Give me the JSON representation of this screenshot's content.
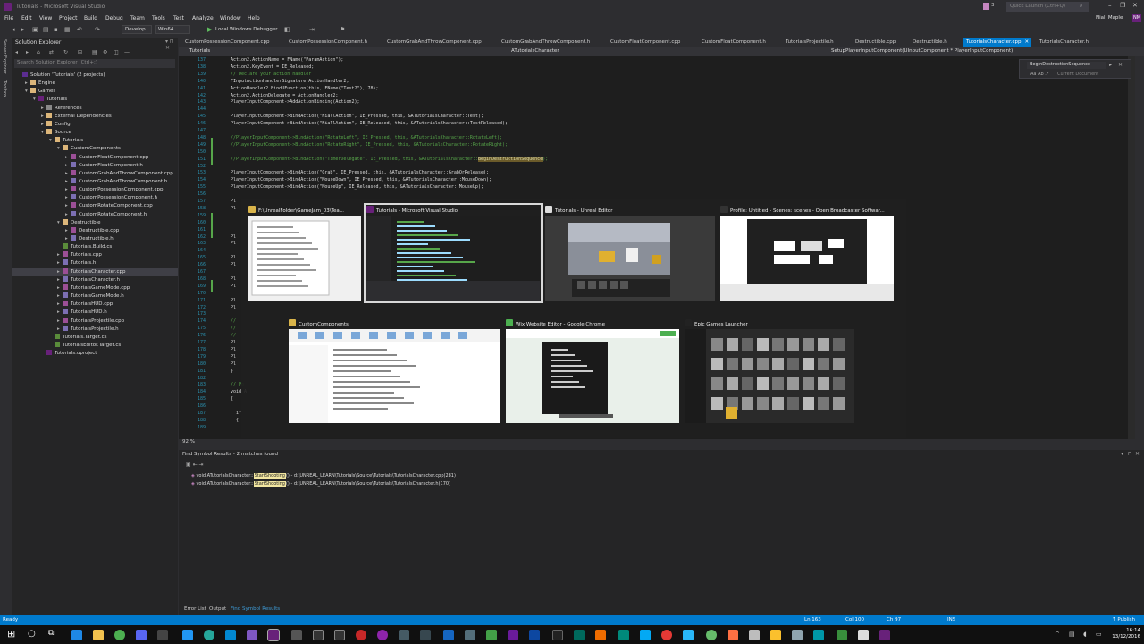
{
  "window": {
    "title": "Tutorials - Microsoft Visual Studio",
    "quick_launch_placeholder": "Quick Launch (Ctrl+Q)",
    "notifications_count": "3",
    "user_name": "Niall Maple",
    "user_initials": "NM"
  },
  "menu": [
    "File",
    "Edit",
    "View",
    "Project",
    "Build",
    "Debug",
    "Team",
    "Tools",
    "Test",
    "Analyze",
    "Window",
    "Help"
  ],
  "toolbar": {
    "config": "Develop",
    "platform": "Win64",
    "debugger": "Local Windows Debugger"
  },
  "side_tabs": [
    "Server Explorer",
    "Toolbox"
  ],
  "solution_explorer": {
    "title": "Solution Explorer",
    "search_placeholder": "Search Solution Explorer (Ctrl+;)",
    "items": [
      {
        "label": "Solution 'Tutorials' (2 projects)",
        "depth": 0,
        "kind": "sol",
        "arrow": ""
      },
      {
        "label": "Engine",
        "depth": 1,
        "kind": "folder",
        "arrow": "▸"
      },
      {
        "label": "Games",
        "depth": 1,
        "kind": "folder",
        "arrow": "▾"
      },
      {
        "label": "Tutorials",
        "depth": 2,
        "kind": "proj",
        "arrow": "▾"
      },
      {
        "label": "References",
        "depth": 3,
        "kind": "ref",
        "arrow": "▸"
      },
      {
        "label": "External Dependencies",
        "depth": 3,
        "kind": "folder",
        "arrow": "▸"
      },
      {
        "label": "Config",
        "depth": 3,
        "kind": "folder",
        "arrow": "▸"
      },
      {
        "label": "Source",
        "depth": 3,
        "kind": "folder",
        "arrow": "▾"
      },
      {
        "label": "Tutorials",
        "depth": 4,
        "kind": "folder",
        "arrow": "▾"
      },
      {
        "label": "CustomComponents",
        "depth": 5,
        "kind": "folder",
        "arrow": "▾"
      },
      {
        "label": "CustomFloatComponent.cpp",
        "depth": 6,
        "kind": "cpp",
        "arrow": "▸"
      },
      {
        "label": "CustomFloatComponent.h",
        "depth": 6,
        "kind": "h",
        "arrow": "▸"
      },
      {
        "label": "CustomGrabAndThrowComponent.cpp",
        "depth": 6,
        "kind": "cpp",
        "arrow": "▸"
      },
      {
        "label": "CustomGrabAndThrowComponent.h",
        "depth": 6,
        "kind": "h",
        "arrow": "▸"
      },
      {
        "label": "CustomPossessionComponent.cpp",
        "depth": 6,
        "kind": "cpp",
        "arrow": "▸"
      },
      {
        "label": "CustomPossessionComponent.h",
        "depth": 6,
        "kind": "h",
        "arrow": "▸"
      },
      {
        "label": "CustomRotateComponent.cpp",
        "depth": 6,
        "kind": "cpp",
        "arrow": "▸"
      },
      {
        "label": "CustomRotateComponent.h",
        "depth": 6,
        "kind": "h",
        "arrow": "▸"
      },
      {
        "label": "Destructible",
        "depth": 5,
        "kind": "folder",
        "arrow": "▾"
      },
      {
        "label": "Destructible.cpp",
        "depth": 6,
        "kind": "cpp",
        "arrow": "▸"
      },
      {
        "label": "Destructible.h",
        "depth": 6,
        "kind": "h",
        "arrow": "▸"
      },
      {
        "label": "Tutorials.Build.cs",
        "depth": 5,
        "kind": "cs",
        "arrow": ""
      },
      {
        "label": "Tutorials.cpp",
        "depth": 5,
        "kind": "cpp",
        "arrow": "▸"
      },
      {
        "label": "Tutorials.h",
        "depth": 5,
        "kind": "h",
        "arrow": "▸"
      },
      {
        "label": "TutorialsCharacter.cpp",
        "depth": 5,
        "kind": "cpp",
        "arrow": "▸",
        "selected": true
      },
      {
        "label": "TutorialsCharacter.h",
        "depth": 5,
        "kind": "h",
        "arrow": "▸"
      },
      {
        "label": "TutorialsGameMode.cpp",
        "depth": 5,
        "kind": "cpp",
        "arrow": "▸"
      },
      {
        "label": "TutorialsGameMode.h",
        "depth": 5,
        "kind": "h",
        "arrow": "▸"
      },
      {
        "label": "TutorialsHUD.cpp",
        "depth": 5,
        "kind": "cpp",
        "arrow": "▸"
      },
      {
        "label": "TutorialsHUD.h",
        "depth": 5,
        "kind": "h",
        "arrow": "▸"
      },
      {
        "label": "TutorialsProjectile.cpp",
        "depth": 5,
        "kind": "cpp",
        "arrow": "▸"
      },
      {
        "label": "TutorialsProjectile.h",
        "depth": 5,
        "kind": "h",
        "arrow": "▸"
      },
      {
        "label": "Tutorials.Target.cs",
        "depth": 4,
        "kind": "cs",
        "arrow": ""
      },
      {
        "label": "TutorialsEditor.Target.cs",
        "depth": 4,
        "kind": "cs",
        "arrow": ""
      },
      {
        "label": "Tutorials.uproject",
        "depth": 3,
        "kind": "proj",
        "arrow": ""
      }
    ]
  },
  "doc_tabs": [
    {
      "label": "CustomPossessionComponent.cpp"
    },
    {
      "label": "CustomPossessionComponent.h"
    },
    {
      "label": "CustomGrabAndThrowComponent.cpp"
    },
    {
      "label": "CustomGrabAndThrowComponent.h"
    },
    {
      "label": "CustomFloatComponent.cpp"
    },
    {
      "label": "CustomFloatComponent.h"
    },
    {
      "label": "TutorialsProjectile.h"
    },
    {
      "label": "Destructible.cpp"
    },
    {
      "label": "Destructible.h"
    },
    {
      "label": "TutorialsCharacter.cpp",
      "active": true
    },
    {
      "label": "TutorialsCharacter.h"
    }
  ],
  "nav": {
    "project": "Tutorials",
    "scope": "ATutorialsCharacter",
    "member": "SetupPlayerInputComponent(UInputComponent * PlayerInputComponent)"
  },
  "find_widget": {
    "query": "BeginDestructionSequence",
    "match_case": "Aa",
    "whole_word": "Ab",
    "regex": ".*",
    "scope": "Current Document"
  },
  "code": [
    {
      "n": "137",
      "t": "Action2.ActionName = FName(\"ParamAction\");",
      "c": ""
    },
    {
      "n": "138",
      "t": "Action2.KeyEvent = IE_Released;",
      "c": ""
    },
    {
      "n": "139",
      "t": "// Declare your action handler",
      "c": "cmt"
    },
    {
      "n": "140",
      "t": "FInputActionHandlerSignature ActionHandler2;",
      "c": ""
    },
    {
      "n": "141",
      "t": "ActionHandler2.BindUFunction(this, FName(\"Test2\"), 78);",
      "c": ""
    },
    {
      "n": "142",
      "t": "Action2.ActionDelegate = ActionHandler2;",
      "c": ""
    },
    {
      "n": "143",
      "t": "PlayerInputComponent->AddActionBinding(Action2);",
      "c": ""
    },
    {
      "n": "144",
      "t": "",
      "c": ""
    },
    {
      "n": "145",
      "t": "PlayerInputComponent->BindAction(\"NiallAction\", IE_Pressed, this, &ATutorialsCharacter::Test);",
      "c": ""
    },
    {
      "n": "146",
      "t": "PlayerInputComponent->BindAction(\"NiallAction\", IE_Released, this, &ATutorialsCharacter::TestReleased);",
      "c": ""
    },
    {
      "n": "147",
      "t": "",
      "c": ""
    },
    {
      "n": "148",
      "t": "//PlayerInputComponent->BindAction(\"RotateLeft\", IE_Pressed, this, &ATutorialsCharacter::RotateLeft);",
      "c": "cmt"
    },
    {
      "n": "149",
      "t": "//PlayerInputComponent->BindAction(\"RotateRight\", IE_Pressed, this, &ATutorialsCharacter::RotateRight);",
      "c": "cmt"
    },
    {
      "n": "150",
      "t": "",
      "c": ""
    },
    {
      "n": "151",
      "t": "//PlayerInputComponent->BindAction(\"TimerDelegate\", IE_Pressed, this, &ATutorialsCharacter::BeginDestructionSequence);",
      "c": "cmt"
    },
    {
      "n": "152",
      "t": "",
      "c": ""
    },
    {
      "n": "153",
      "t": "PlayerInputComponent->BindAction(\"Grab\", IE_Pressed, this, &ATutorialsCharacter::GrabOrRelease);",
      "c": ""
    },
    {
      "n": "154",
      "t": "PlayerInputComponent->BindAction(\"MouseDown\", IE_Pressed, this, &ATutorialsCharacter::MouseDown);",
      "c": ""
    },
    {
      "n": "155",
      "t": "PlayerInputComponent->BindAction(\"MouseUp\", IE_Released, this, &ATutorialsCharacter::MouseUp);",
      "c": ""
    },
    {
      "n": "156",
      "t": "",
      "c": ""
    },
    {
      "n": "157",
      "t": "Pl",
      "c": ""
    },
    {
      "n": "158",
      "t": "Pl",
      "c": ""
    },
    {
      "n": "159",
      "t": "",
      "c": ""
    },
    {
      "n": "160",
      "t": "",
      "c": ""
    },
    {
      "n": "161",
      "t": "",
      "c": ""
    },
    {
      "n": "162",
      "t": "Pl",
      "c": ""
    },
    {
      "n": "163",
      "t": "Pl",
      "c": ""
    },
    {
      "n": "164",
      "t": "",
      "c": ""
    },
    {
      "n": "165",
      "t": "Pl",
      "c": ""
    },
    {
      "n": "166",
      "t": "Pl",
      "c": ""
    },
    {
      "n": "167",
      "t": "",
      "c": ""
    },
    {
      "n": "168",
      "t": "Pl",
      "c": ""
    },
    {
      "n": "169",
      "t": "Pl",
      "c": ""
    },
    {
      "n": "170",
      "t": "",
      "c": ""
    },
    {
      "n": "171",
      "t": "Pl",
      "c": ""
    },
    {
      "n": "172",
      "t": "Pl",
      "c": ""
    },
    {
      "n": "173",
      "t": "",
      "c": ""
    },
    {
      "n": "174",
      "t": "//",
      "c": "cmt"
    },
    {
      "n": "175",
      "t": "//",
      "c": "cmt"
    },
    {
      "n": "176",
      "t": "//",
      "c": "cmt"
    },
    {
      "n": "177",
      "t": "Pl",
      "c": ""
    },
    {
      "n": "178",
      "t": "Pl",
      "c": ""
    },
    {
      "n": "179",
      "t": "Pl",
      "c": ""
    },
    {
      "n": "180",
      "t": "Pl",
      "c": ""
    },
    {
      "n": "181",
      "t": "}",
      "c": ""
    },
    {
      "n": "182",
      "t": "",
      "c": ""
    },
    {
      "n": "183",
      "t": "// Po",
      "c": "cmt"
    },
    {
      "n": "184",
      "t": "void A",
      "c": ""
    },
    {
      "n": "185",
      "t": "{",
      "c": ""
    },
    {
      "n": "186",
      "t": "",
      "c": ""
    },
    {
      "n": "187",
      "t": "  if",
      "c": ""
    },
    {
      "n": "188",
      "t": "  {",
      "c": ""
    },
    {
      "n": "189",
      "t": "",
      "c": ""
    }
  ],
  "editor_zoom": "92 %",
  "alt_tab": [
    {
      "title": "F:\\UnrealFolder\\GameJam_03\\Tea...",
      "icon": "#d9b44a",
      "theme": "doc"
    },
    {
      "title": "Tutorials - Microsoft Visual Studio",
      "icon": "#68217a",
      "theme": "vs",
      "selected": true
    },
    {
      "title": "Tutorials - Unreal Editor",
      "icon": "#dddddd",
      "theme": "ue"
    },
    {
      "title": "Profile: Untitled - Scenes: scenes - Open Broadcaster Softwar...",
      "icon": "#333333",
      "theme": "obs"
    },
    {
      "title": "CustomComponents",
      "icon": "#d9b44a",
      "theme": "explorer"
    },
    {
      "title": "Wix Website Editor - Google Chrome",
      "icon": "#4caf50",
      "theme": "wix"
    },
    {
      "title": "Epic Games Launcher",
      "icon": "#222222",
      "theme": "epic"
    }
  ],
  "find_results": {
    "title": "Find Symbol Results - 2 matches found",
    "rows": [
      {
        "pre": "void ATutorialsCharacter::",
        "match": "StartShooting",
        "post": "() - d:\\UNREAL_LEARN\\Tutorials\\Source\\Tutorials\\TutorialsCharacter.cpp(281)"
      },
      {
        "pre": "void ATutorialsCharacter::",
        "match": "StartShooting",
        "post": "() - d:\\UNREAL_LEARN\\Tutorials\\Source\\Tutorials\\TutorialsCharacter.h(170)"
      }
    ]
  },
  "bottom_tabs": [
    {
      "label": "Error List"
    },
    {
      "label": "Output"
    },
    {
      "label": "Find Symbol Results",
      "active": true
    }
  ],
  "status": {
    "ready": "Ready",
    "line": "Ln 163",
    "col": "Col 100",
    "ch": "Ch 97",
    "ins": "INS",
    "publish": "↑ Publish"
  },
  "clock": {
    "time": "16:14",
    "date": "13/12/2016"
  },
  "colors": {
    "accent": "#007acc",
    "vs_purple": "#68217a",
    "editor_bg": "#1e1e1e",
    "chrome_bg": "#2d2d30"
  }
}
